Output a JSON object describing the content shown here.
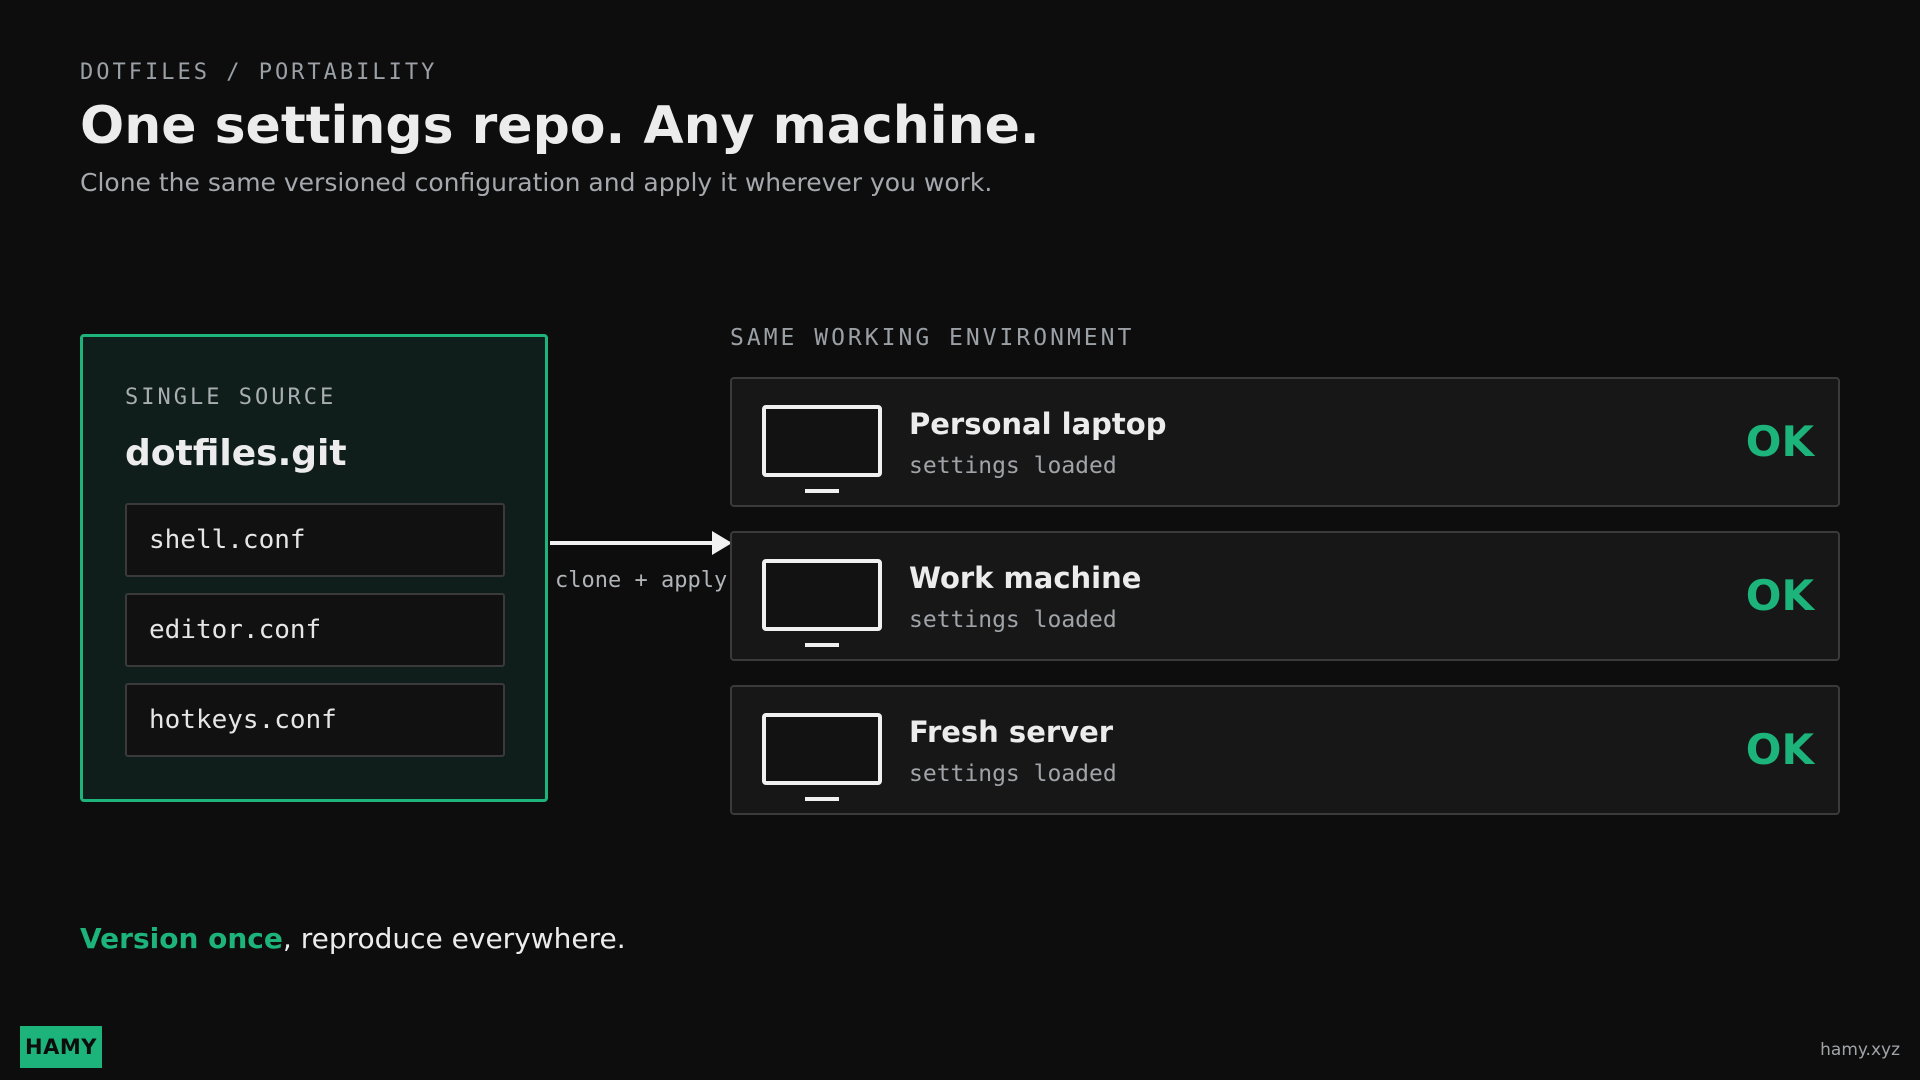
{
  "header": {
    "kicker": "DOTFILES / PORTABILITY",
    "title": "One settings repo. Any machine.",
    "subtitle": "Clone the same versioned configuration and apply it wherever you work."
  },
  "source": {
    "label": "SINGLE SOURCE",
    "name": "dotfiles.git",
    "files": [
      "shell.conf",
      "editor.conf",
      "hotkeys.conf"
    ]
  },
  "arrow": {
    "label": "clone + apply"
  },
  "environment": {
    "label": "SAME WORKING ENVIRONMENT",
    "machines": [
      {
        "name": "Personal laptop",
        "status_text": "settings loaded",
        "status": "OK",
        "icon": "monitor-icon"
      },
      {
        "name": "Work machine",
        "status_text": "settings loaded",
        "status": "OK",
        "icon": "monitor-icon"
      },
      {
        "name": "Fresh server",
        "status_text": "settings loaded",
        "status": "OK",
        "icon": "monitor-icon"
      }
    ]
  },
  "tagline": {
    "accent": "Version once",
    "rest": ", reproduce everywhere."
  },
  "footer": {
    "brand": "HAMY",
    "url": "hamy.xyz"
  },
  "colors": {
    "background": "#0d0d0d",
    "accent": "#1db47c",
    "source_card_bg": "#0f1e1a",
    "card_bg": "#171717",
    "border": "#3a3a3a"
  }
}
